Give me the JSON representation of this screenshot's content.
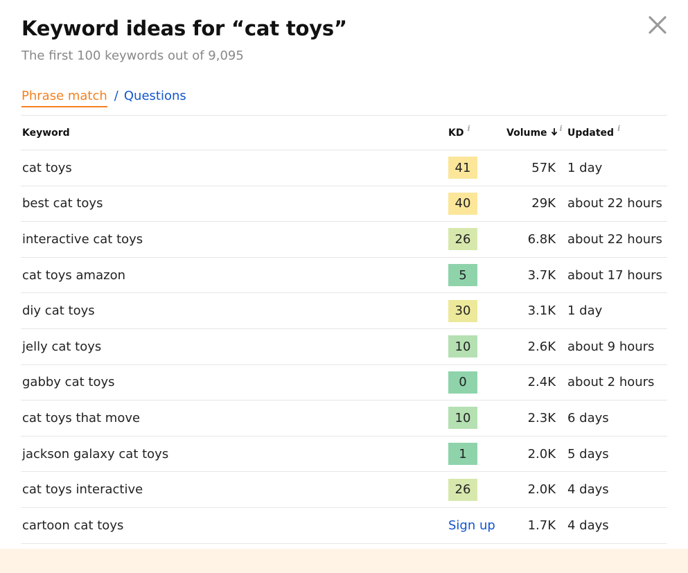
{
  "header": {
    "title": "Keyword ideas for “cat toys”",
    "subtitle": "The first 100 keywords out of 9,095",
    "close_icon": "close-icon"
  },
  "tabs": {
    "active_label": "Phrase match",
    "separator": "/",
    "other_label": "Questions",
    "active_color": "#f4801f",
    "link_color": "#1155cc"
  },
  "table": {
    "columns": {
      "keyword": "Keyword",
      "kd": "KD",
      "volume": "Volume",
      "updated": "Updated",
      "info_mark": "i"
    },
    "rows": [
      {
        "keyword": "cat toys",
        "kd": "41",
        "kd_color": "#fbe69a",
        "volume": "57K",
        "updated": "1 day"
      },
      {
        "keyword": "best cat toys",
        "kd": "40",
        "kd_color": "#fbe69a",
        "volume": "29K",
        "updated": "about 22 hours"
      },
      {
        "keyword": "interactive cat toys",
        "kd": "26",
        "kd_color": "#d7e8ad",
        "volume": "6.8K",
        "updated": "about 22 hours"
      },
      {
        "keyword": "cat toys amazon",
        "kd": "5",
        "kd_color": "#8fd3ab",
        "volume": "3.7K",
        "updated": "about 17 hours"
      },
      {
        "keyword": "diy cat toys",
        "kd": "30",
        "kd_color": "#ece99a",
        "volume": "3.1K",
        "updated": "1 day"
      },
      {
        "keyword": "jelly cat toys",
        "kd": "10",
        "kd_color": "#b5e0b2",
        "volume": "2.6K",
        "updated": "about 9 hours"
      },
      {
        "keyword": "gabby cat toys",
        "kd": "0",
        "kd_color": "#8fd3ab",
        "volume": "2.4K",
        "updated": "about 2 hours"
      },
      {
        "keyword": "cat toys that move",
        "kd": "10",
        "kd_color": "#b5e0b2",
        "volume": "2.3K",
        "updated": "6 days"
      },
      {
        "keyword": "jackson galaxy cat toys",
        "kd": "1",
        "kd_color": "#8fd3ab",
        "volume": "2.0K",
        "updated": "5 days"
      },
      {
        "keyword": "cat toys interactive",
        "kd": "26",
        "kd_color": "#d7e8ad",
        "volume": "2.0K",
        "updated": "4 days"
      },
      {
        "keyword": "cartoon cat toys",
        "kd_link": "Sign up",
        "volume": "1.7K",
        "updated": "4 days"
      }
    ]
  },
  "footer": {
    "band_color": "#fff3e6"
  }
}
